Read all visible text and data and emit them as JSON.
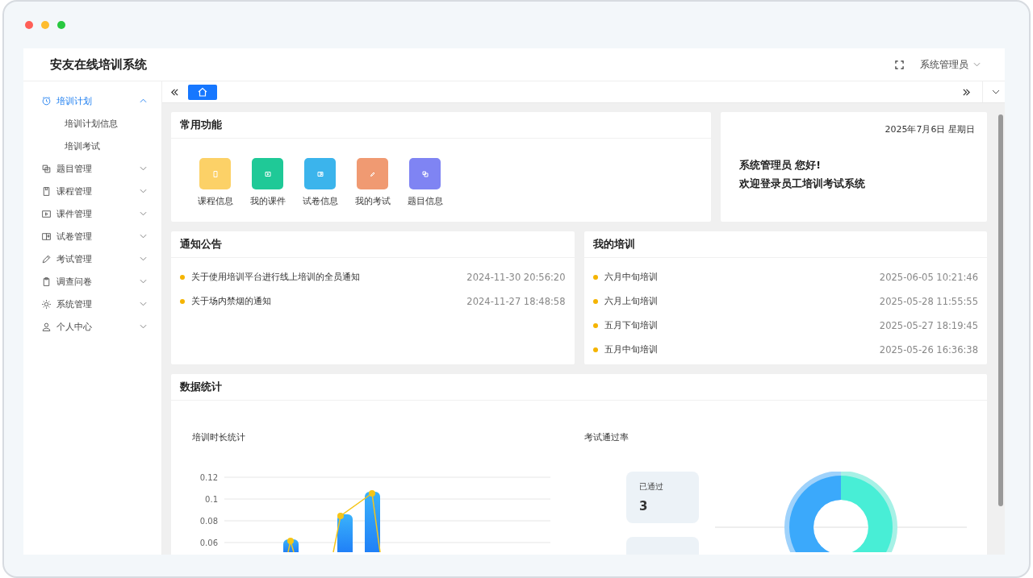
{
  "header": {
    "title": "安友在线培训系统",
    "user": "系统管理员"
  },
  "sidebar": {
    "items": [
      {
        "label": "培训计划",
        "expanded": true,
        "selected": true,
        "children": [
          {
            "label": "培训计划信息",
            "selected": false
          },
          {
            "label": "培训考试",
            "selected": false
          }
        ]
      },
      {
        "label": "题目管理",
        "expanded": false,
        "selected": false
      },
      {
        "label": "课程管理",
        "expanded": false,
        "selected": false
      },
      {
        "label": "课件管理",
        "expanded": false,
        "selected": false
      },
      {
        "label": "试卷管理",
        "expanded": false,
        "selected": false
      },
      {
        "label": "考试管理",
        "expanded": false,
        "selected": false
      },
      {
        "label": "调查问卷",
        "expanded": false,
        "selected": false
      },
      {
        "label": "系统管理",
        "expanded": false,
        "selected": false
      },
      {
        "label": "个人中心",
        "expanded": false,
        "selected": false
      }
    ]
  },
  "quick_functions": {
    "title": "常用功能",
    "items": [
      {
        "label": "课程信息",
        "color": "#fcd167"
      },
      {
        "label": "我的课件",
        "color": "#1fc997"
      },
      {
        "label": "试卷信息",
        "color": "#3bb4ec"
      },
      {
        "label": "我的考试",
        "color": "#f09a72"
      },
      {
        "label": "题目信息",
        "color": "#7f84f3"
      }
    ]
  },
  "welcome": {
    "date": "2025年7月6日 星期日",
    "greeting": "系统管理员 您好!",
    "message": "欢迎登录员工培训考试系统"
  },
  "notices": {
    "title": "通知公告",
    "items": [
      {
        "text": "关于使用培训平台进行线上培训的全员通知",
        "time": "2024-11-30 20:56:20"
      },
      {
        "text": "关于场内禁烟的通知",
        "time": "2024-11-27 18:48:58"
      }
    ]
  },
  "my_training": {
    "title": "我的培训",
    "items": [
      {
        "text": "六月中旬培训",
        "time": "2025-06-05 10:21:46"
      },
      {
        "text": "六月上旬培训",
        "time": "2025-05-28 11:55:55"
      },
      {
        "text": "五月下旬培训",
        "time": "2025-05-27 18:19:45"
      },
      {
        "text": "五月中旬培训",
        "time": "2025-05-26 16:36:38"
      }
    ]
  },
  "statistics": {
    "title": "数据统计",
    "duration_chart": {
      "title": "培训时长统计",
      "y_tick_labels": [
        "0.12",
        "0.1",
        "0.08",
        "0.06"
      ]
    },
    "pass_rate": {
      "title": "考试通过率",
      "stats": [
        {
          "label": "已通过",
          "value": "3"
        }
      ]
    }
  }
}
